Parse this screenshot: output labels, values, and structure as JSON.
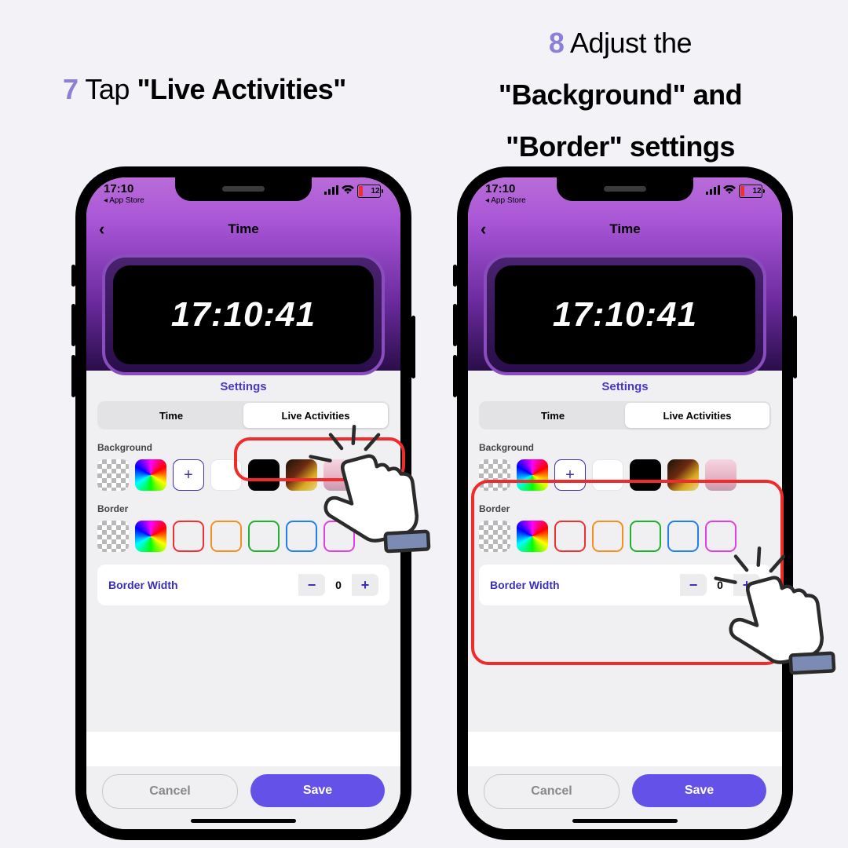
{
  "step7": {
    "num": "7",
    "text_a": "Tap ",
    "text_b": "\"Live Activities\""
  },
  "step8": {
    "num": "8",
    "line1_a": "Adjust the",
    "line2": "\"Background\" and",
    "line3": "\"Border\" settings"
  },
  "phone": {
    "status_time": "17:10",
    "back_link": "◂ App Store",
    "battery": "12",
    "screen_title": "Time",
    "widget_time": "17:10:41",
    "settings_heading": "Settings",
    "tabs": [
      "Time",
      "Live Activities"
    ],
    "bg_label": "Background",
    "border_label": "Border",
    "stepper_label": "Border Width",
    "stepper_value": "0",
    "cancel": "Cancel",
    "save": "Save"
  }
}
